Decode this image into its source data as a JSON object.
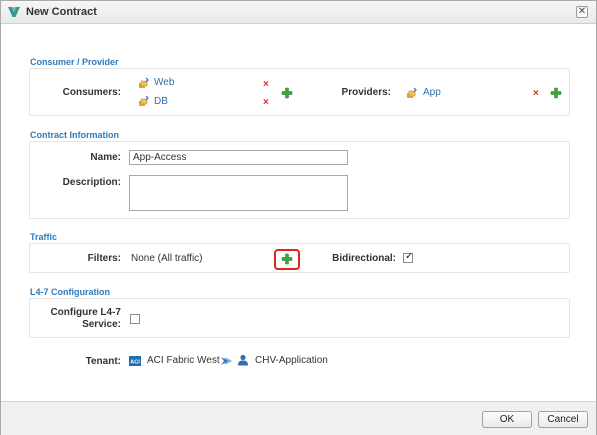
{
  "dialog": {
    "title": "New Contract",
    "close_glyph": "✕"
  },
  "consumer_provider": {
    "section_title": "Consumer / Provider",
    "consumers_label": "Consumers:",
    "consumers": [
      {
        "name": "Web",
        "icon": "epg-icon"
      },
      {
        "name": "DB",
        "icon": "epg-icon"
      }
    ],
    "providers_label": "Providers:",
    "providers": [
      {
        "name": "App",
        "icon": "epg-icon"
      }
    ],
    "remove_glyph": "×"
  },
  "contract_information": {
    "section_title": "Contract Information",
    "name_label": "Name:",
    "name_value": "App-Access",
    "description_label": "Description:",
    "description_value": ""
  },
  "traffic": {
    "section_title": "Traffic",
    "filters_label": "Filters:",
    "filters_value": "None (All traffic)",
    "bidirectional_label": "Bidirectional:",
    "bidirectional_checked": true,
    "check_glyph": "✓"
  },
  "l47": {
    "section_title": "L4-7 Configuration",
    "configure_label_line1": "Configure L4-7",
    "configure_label_line2": "Service:",
    "configure_checked": false
  },
  "tenant": {
    "label": "Tenant:",
    "aci_badge": "ACI",
    "fabric_name": "ACI Fabric West",
    "application_name": "CHV-Application"
  },
  "footer": {
    "ok_label": "OK",
    "cancel_label": "Cancel"
  },
  "colors": {
    "section_title": "#2f7bbf",
    "link": "#2f6fb0",
    "remove": "#d0302a",
    "add": "#3aa63a",
    "highlight": "#e1251b"
  }
}
